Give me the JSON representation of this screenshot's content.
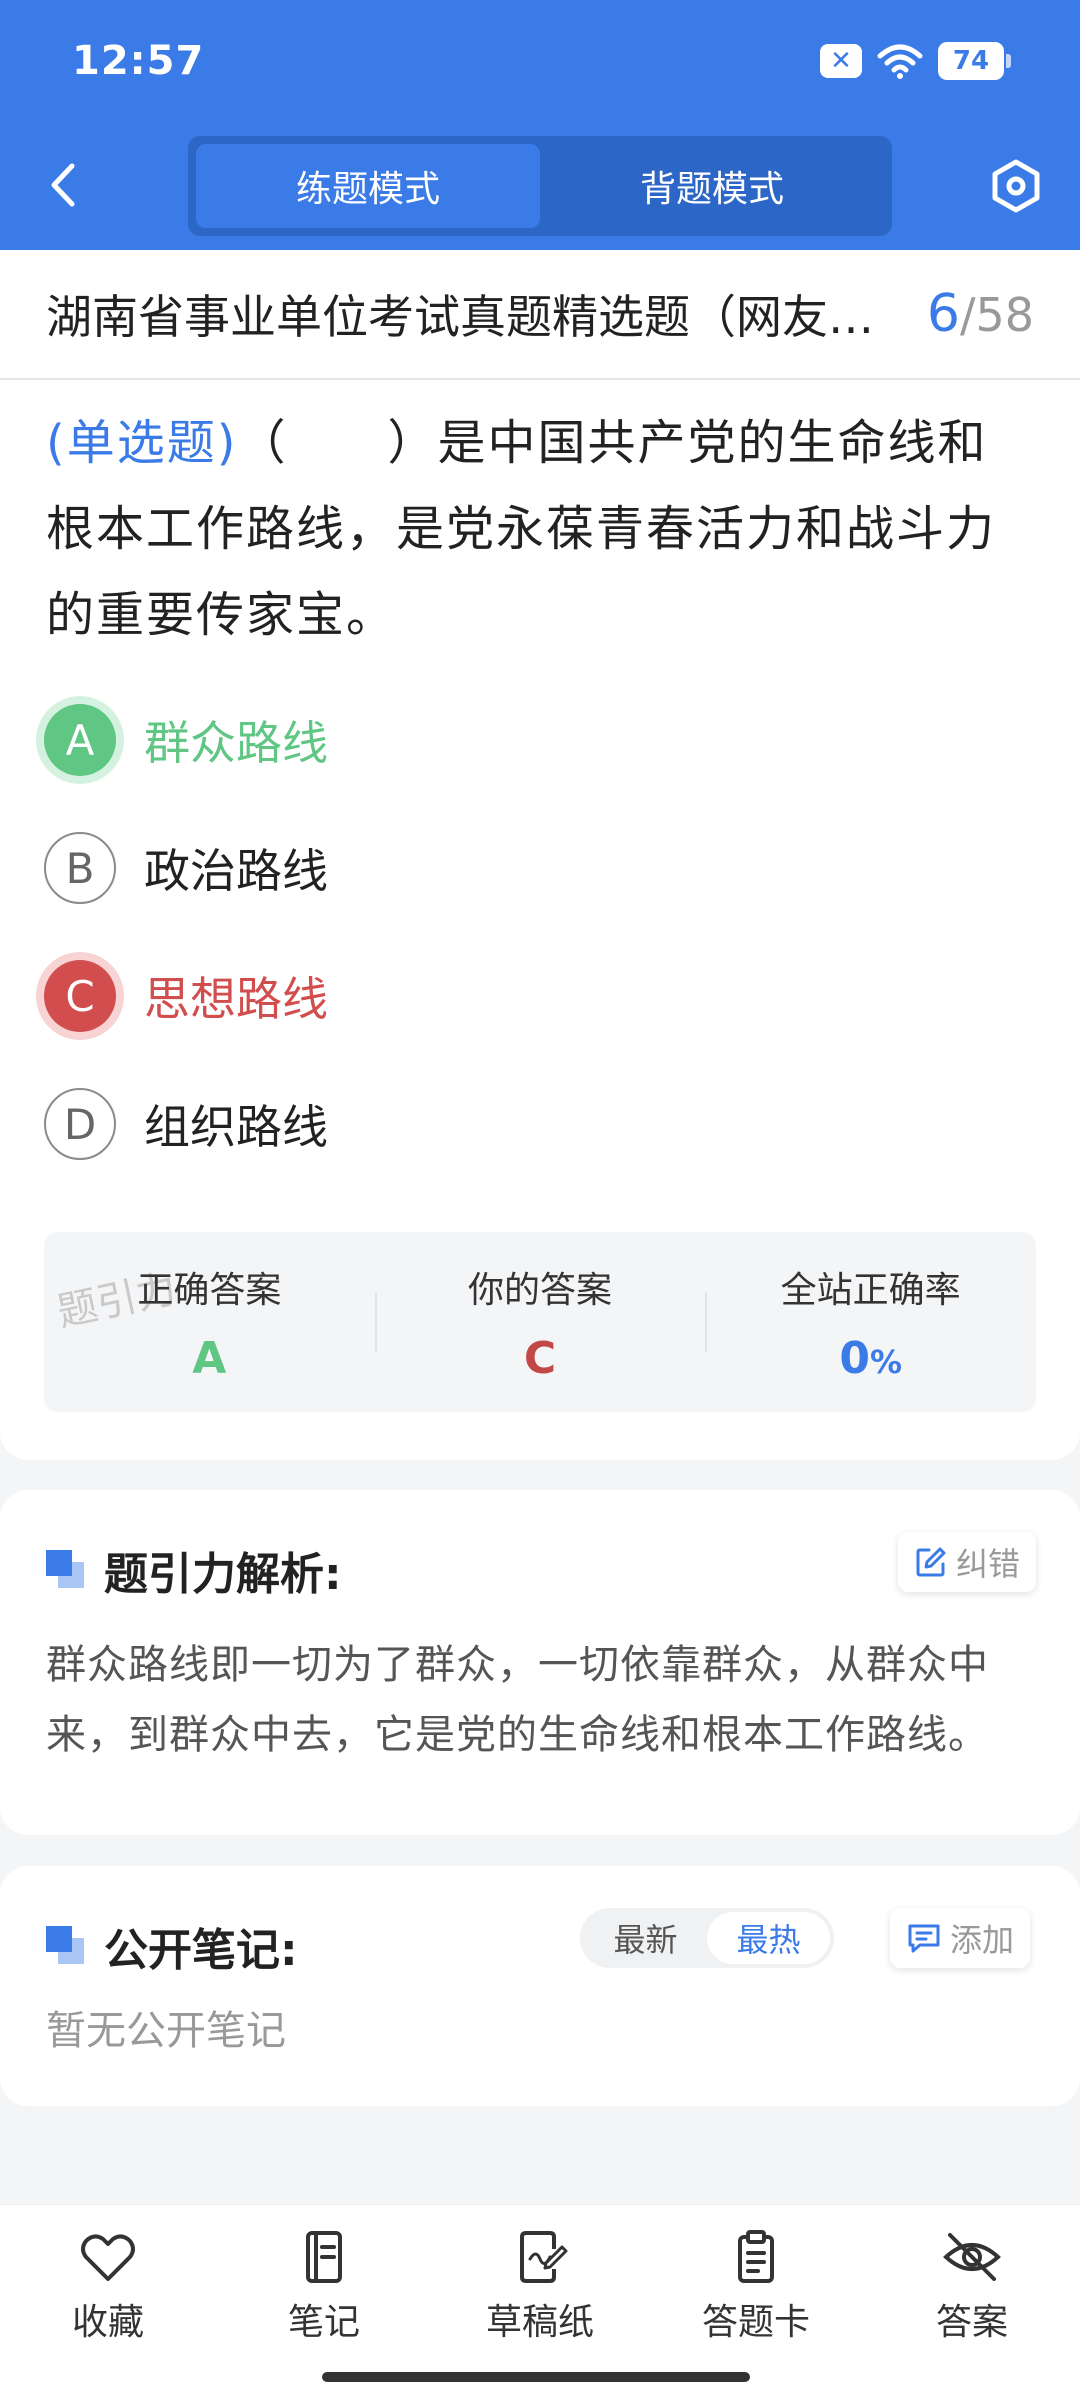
{
  "status_bar": {
    "time": "12:57",
    "battery": "74",
    "notif_badge": "✕"
  },
  "header": {
    "modes": [
      {
        "label": "练题模式",
        "active": true
      },
      {
        "label": "背题模式",
        "active": false
      }
    ]
  },
  "question": {
    "title": "湖南省事业单位考试真题精选题（网友回忆版）",
    "current": "6",
    "total": "/58",
    "type": "(单选题)",
    "text": "（　　）是中国共产党的生命线和根本工作路线，是党永葆青春活力和战斗力的重要传家宝。",
    "options": [
      {
        "key": "A",
        "label": "群众路线",
        "state": "correct"
      },
      {
        "key": "B",
        "label": "政治路线",
        "state": "normal"
      },
      {
        "key": "C",
        "label": "思想路线",
        "state": "wrong"
      },
      {
        "key": "D",
        "label": "组织路线",
        "state": "normal"
      }
    ]
  },
  "result": {
    "watermark": "题引力",
    "correct_label": "正确答案",
    "correct_value": "A",
    "yours_label": "你的答案",
    "yours_value": "C",
    "rate_label": "全站正确率",
    "rate_value": "0",
    "rate_unit": "%"
  },
  "explanation": {
    "title": "题引力解析:",
    "report_label": "纠错",
    "text": "群众路线即一切为了群众，一切依靠群众，从群众中来，到群众中去，它是党的生命线和根本工作路线。"
  },
  "notes": {
    "title": "公开笔记:",
    "sort_options": [
      "最新",
      "最热"
    ],
    "add_label": "添加",
    "empty_text": "暂无公开笔记"
  },
  "bottom_nav": [
    {
      "label": "收藏",
      "icon": "heart-icon"
    },
    {
      "label": "笔记",
      "icon": "notebook-icon"
    },
    {
      "label": "草稿纸",
      "icon": "draft-icon"
    },
    {
      "label": "答题卡",
      "icon": "answer-card-icon"
    },
    {
      "label": "答案",
      "icon": "eye-off-icon"
    }
  ],
  "colors": {
    "primary": "#3b7be8",
    "correct": "#5fc684",
    "wrong": "#d24e4e"
  }
}
